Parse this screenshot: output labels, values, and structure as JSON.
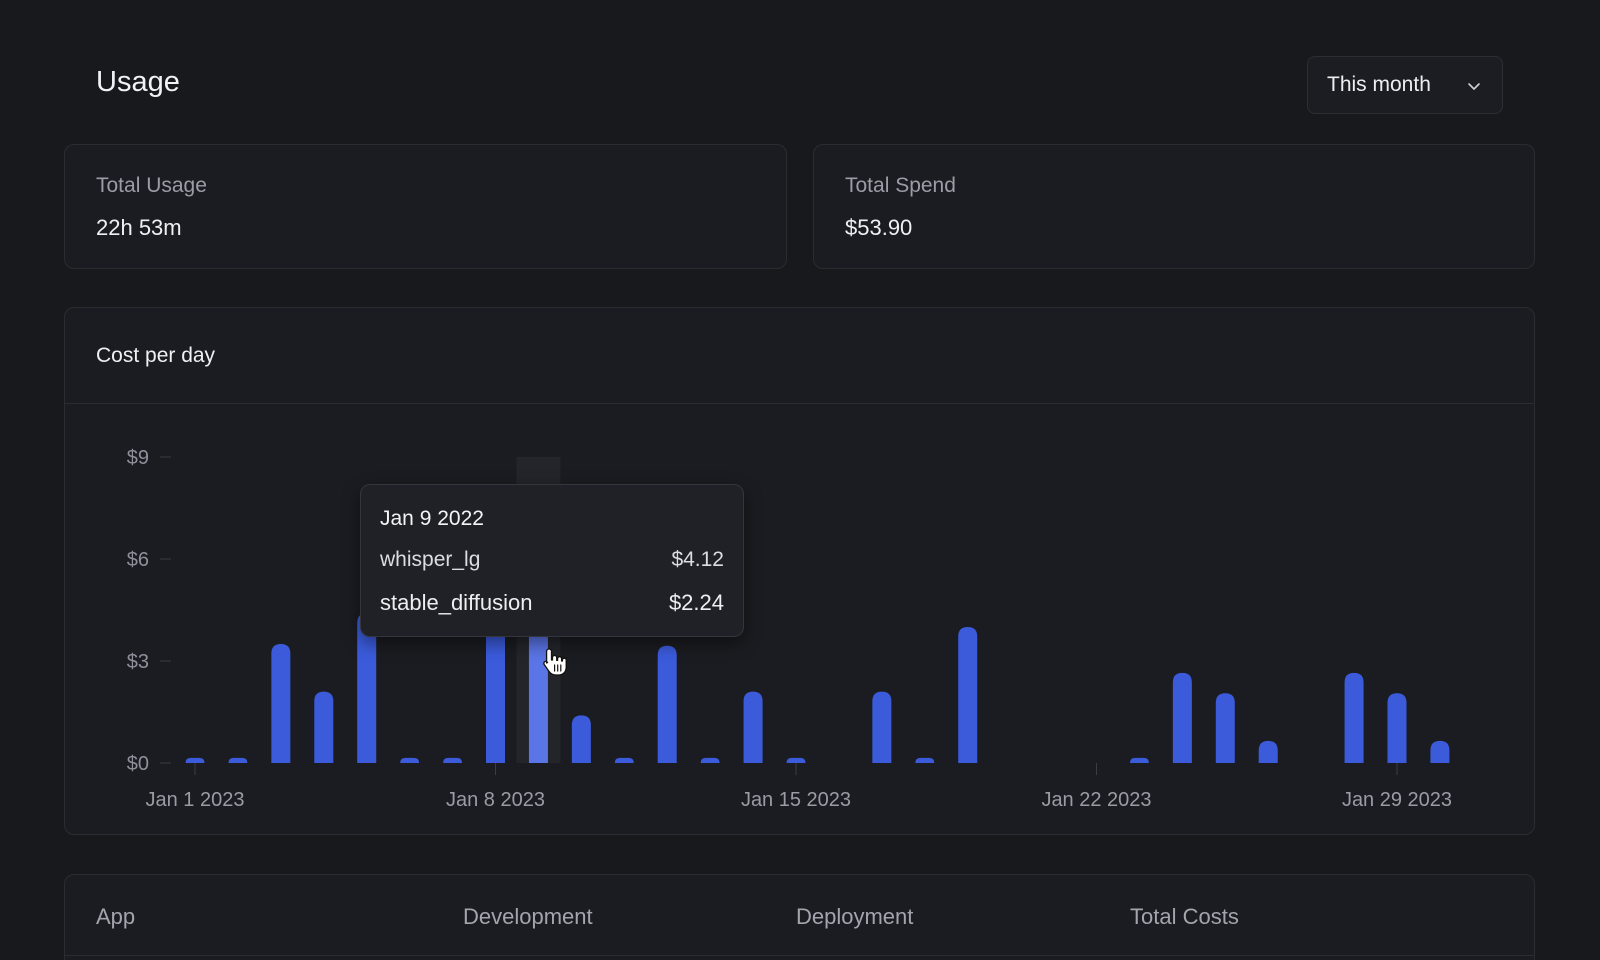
{
  "header": {
    "title": "Usage",
    "period": "This month"
  },
  "stats": [
    {
      "label": "Total Usage",
      "value": "22h 53m"
    },
    {
      "label": "Total Spend",
      "value": "$53.90"
    }
  ],
  "chart": {
    "title": "Cost per day"
  },
  "chart_data": {
    "type": "bar",
    "title": "Cost per day",
    "x": [
      1,
      2,
      3,
      4,
      5,
      6,
      7,
      8,
      9,
      10,
      11,
      12,
      13,
      14,
      15,
      16,
      17,
      18,
      19,
      20,
      21,
      22,
      23,
      24,
      25,
      26,
      27,
      28,
      29,
      30,
      31
    ],
    "values": [
      0.15,
      0.15,
      3.5,
      2.1,
      4.4,
      0.15,
      0.15,
      4.1,
      6.36,
      1.4,
      0.15,
      3.45,
      0.15,
      2.1,
      0.15,
      0,
      2.1,
      0.15,
      4.0,
      0,
      0,
      0,
      0.15,
      2.65,
      2.05,
      0.65,
      0,
      2.65,
      2.05,
      0.65,
      0
    ],
    "xtick_values": [
      1,
      8,
      15,
      22,
      29
    ],
    "xtick_labels": [
      "Jan 1 2023",
      "Jan 8 2023",
      "Jan 15 2023",
      "Jan 22 2023",
      "Jan 29 2023"
    ],
    "ytick_values": [
      0,
      3,
      6,
      9
    ],
    "ytick_labels": [
      "$0",
      "$3",
      "$6",
      "$9"
    ],
    "ylim": [
      0,
      9
    ],
    "highlight_x": 9,
    "bar_color": "#3b5bdb",
    "highlight_color": "#5a75e6",
    "grid": false
  },
  "tooltip": {
    "date": "Jan 9 2022",
    "rows": [
      {
        "name": "whisper_lg",
        "value": "$4.12"
      },
      {
        "name": "stable_diffusion",
        "value": "$2.24"
      }
    ]
  },
  "table": {
    "columns": [
      "App",
      "Development",
      "Deployment",
      "Total Costs"
    ]
  }
}
